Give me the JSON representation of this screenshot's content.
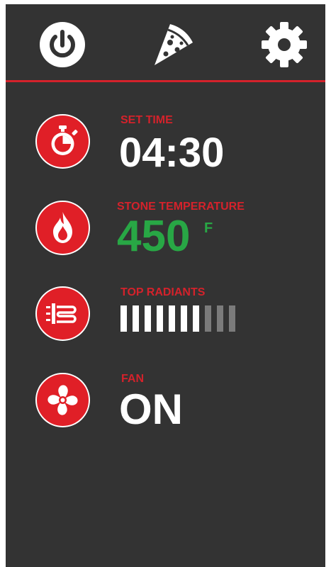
{
  "colors": {
    "background": "#333333",
    "accent": "#d4222b",
    "icon_circle": "#e01f27",
    "temperature_green": "#28a745",
    "bar_on": "#ffffff",
    "bar_off": "#7b7b7b"
  },
  "header": {
    "icons": [
      "power-icon",
      "pizza-icon",
      "gear-icon"
    ]
  },
  "set_time": {
    "icon": "stopwatch-icon",
    "label": "SET TIME",
    "value": "04:30"
  },
  "stone_temperature": {
    "icon": "flame-icon",
    "label": "STONE TEMPERATURE",
    "value": "450",
    "unit": "F"
  },
  "top_radiants": {
    "icon": "heating-element-icon",
    "label": "TOP RADIANTS",
    "level": 7,
    "max_level": 10
  },
  "fan": {
    "icon": "fan-icon",
    "label": "FAN",
    "value": "ON"
  }
}
